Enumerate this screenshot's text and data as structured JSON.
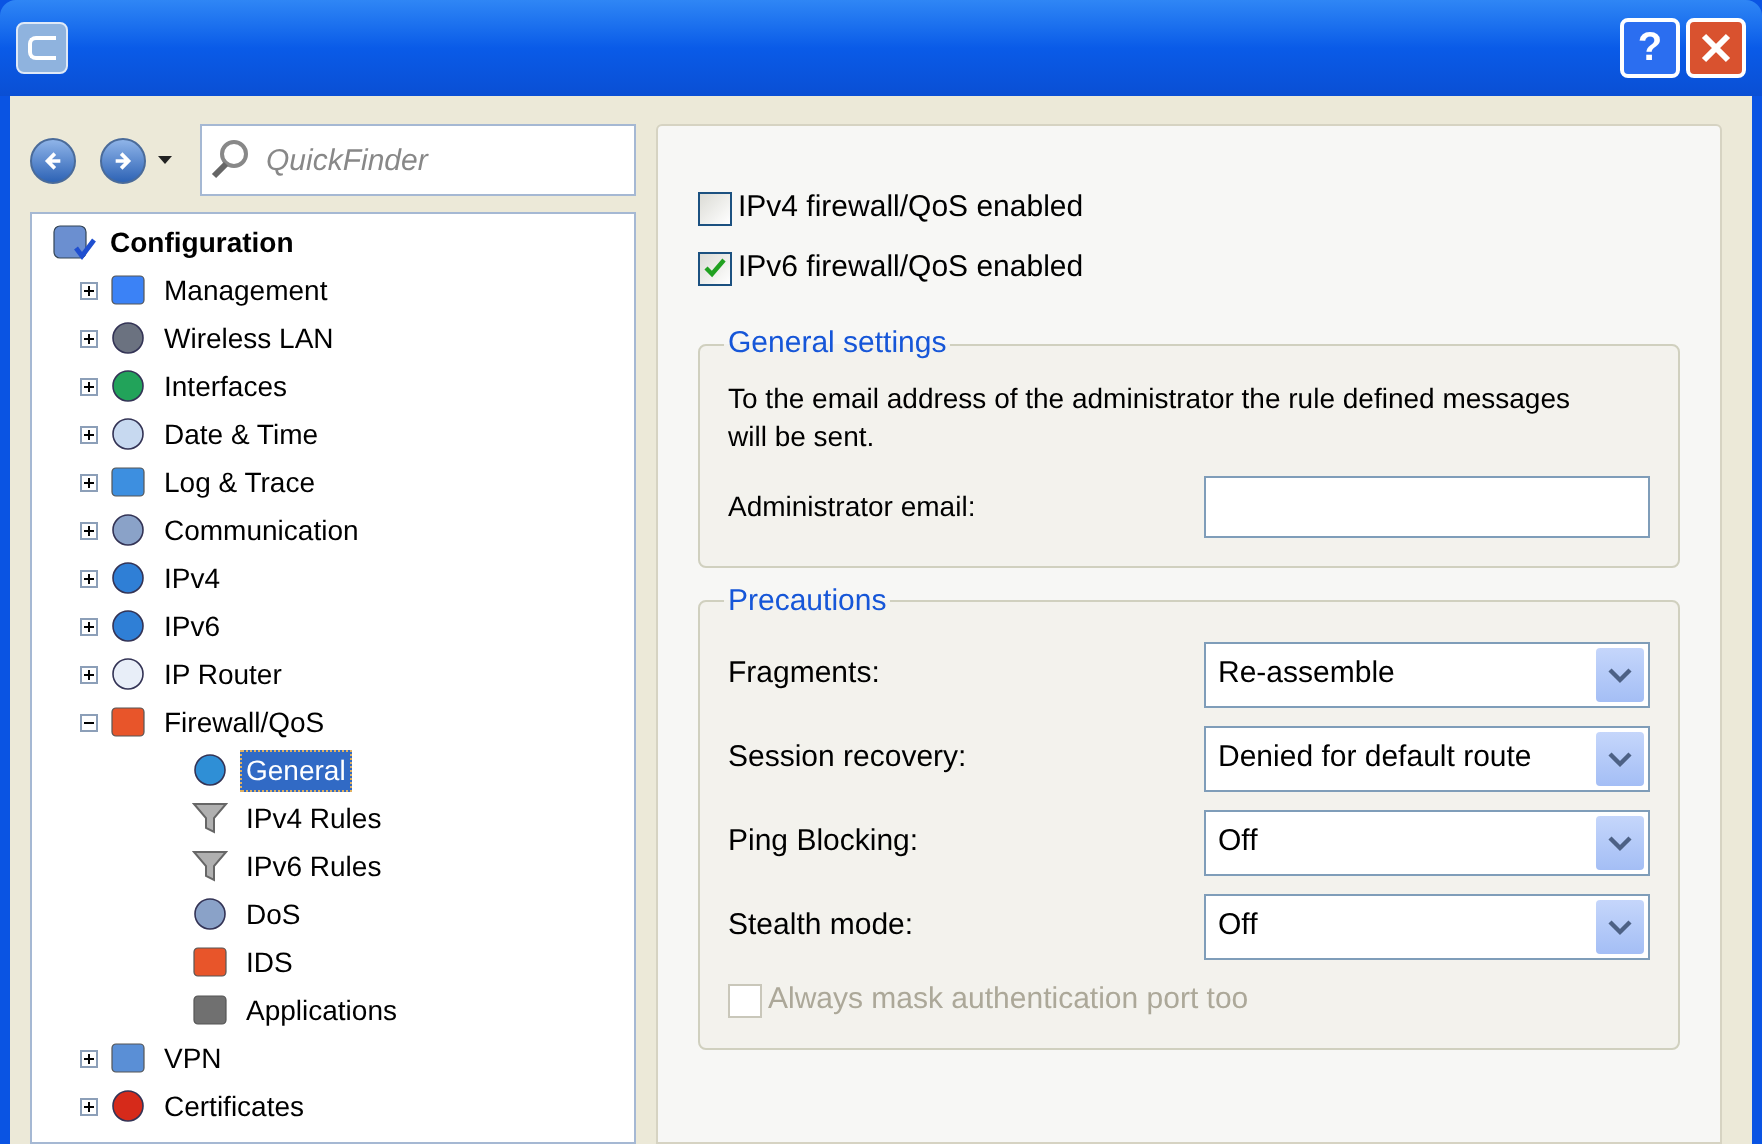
{
  "window": {
    "help_button": "?"
  },
  "navigation": {
    "search": {
      "placeholder": "QuickFinder"
    }
  },
  "tree": {
    "label": "Configuration",
    "children": [
      {
        "label": "Management",
        "expanded": false,
        "selected": false
      },
      {
        "label": "Wireless LAN",
        "expanded": false,
        "selected": false
      },
      {
        "label": "Interfaces",
        "expanded": false,
        "selected": false
      },
      {
        "label": "Date & Time",
        "expanded": false,
        "selected": false
      },
      {
        "label": "Log & Trace",
        "expanded": false,
        "selected": false
      },
      {
        "label": "Communication",
        "expanded": false,
        "selected": false
      },
      {
        "label": "IPv4",
        "expanded": false,
        "selected": false
      },
      {
        "label": "IPv6",
        "expanded": false,
        "selected": false
      },
      {
        "label": "IP Router",
        "expanded": false,
        "selected": false
      },
      {
        "label": "Firewall/QoS",
        "expanded": true,
        "selected": false,
        "children": [
          {
            "label": "General",
            "selected": true
          },
          {
            "label": "IPv4 Rules",
            "selected": false
          },
          {
            "label": "IPv6 Rules",
            "selected": false
          },
          {
            "label": "DoS",
            "selected": false
          },
          {
            "label": "IDS",
            "selected": false
          },
          {
            "label": "Applications",
            "selected": false
          }
        ]
      },
      {
        "label": "VPN",
        "expanded": false,
        "selected": false
      },
      {
        "label": "Certificates",
        "expanded": false,
        "selected": false
      }
    ]
  },
  "options": [
    {
      "label": "IPv4 firewall/QoS enabled",
      "checked": false
    },
    {
      "label": "IPv6 firewall/QoS enabled",
      "checked": true
    }
  ],
  "general_settings": {
    "title": "General settings",
    "description": "To the email address of the administrator the rule defined messages will be sent.",
    "fields": [
      {
        "label": "Administrator email:"
      }
    ]
  },
  "precautions": {
    "title": "Precautions",
    "selects": [
      {
        "label": "Fragments:",
        "value": "Re-assemble"
      },
      {
        "label": "Session recovery:",
        "value": "Denied for default route"
      },
      {
        "label": "Ping Blocking:",
        "value": "Off"
      },
      {
        "label": "Stealth mode:",
        "value": "Off"
      }
    ],
    "checkbox": {
      "label": "Always mask authentication port too",
      "checked": false,
      "disabled": true
    }
  }
}
